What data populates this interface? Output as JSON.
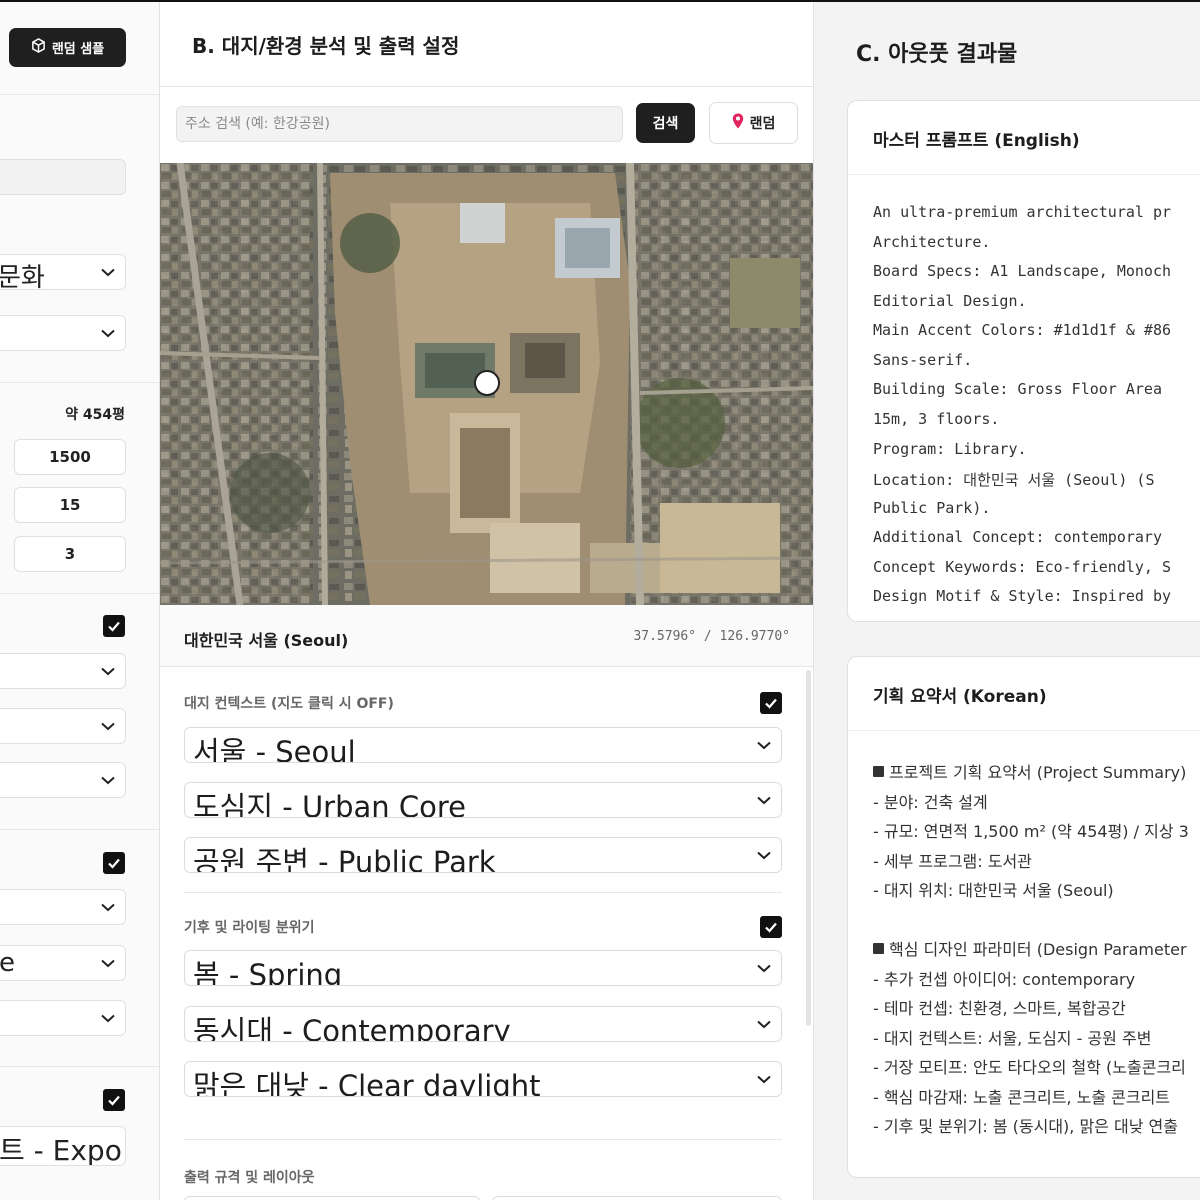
{
  "panel_a": {
    "random_sample_label": "랜덤 샘플",
    "culture_select_value": "문화",
    "area_display": "약 454평",
    "gross_floor_area": "1500",
    "height": "15",
    "floors": "3",
    "expo_select_value": "트 - Expo",
    "partial_select_e": "e"
  },
  "panel_b": {
    "title": "B. 대지/환경 분석 및 출력 설정",
    "search_placeholder": "주소 검색 (예: 한강공원)",
    "search_button": "검색",
    "random_button": "랜덤",
    "location_name": "대한민국 서울 (Seoul)",
    "coordinates": "37.5796° / 126.9770°",
    "site_context": {
      "label": "대지 컨텍스트 (지도 클릭 시 OFF)",
      "checked": true,
      "selects": [
        "서울 - Seoul",
        "도심지 - Urban Core",
        "공원 주변 - Public Park"
      ]
    },
    "climate": {
      "label": "기후 및 라이팅 분위기",
      "checked": true,
      "selects": [
        "봄 - Spring",
        "동시대 - Contemporary",
        "맑은 대낮 - Clear daylight"
      ]
    },
    "output_label": "출력 규격 및 레이아웃"
  },
  "panel_c": {
    "title": "C. 아웃풋 결과물",
    "master_prompt": {
      "header": "마스터 프롬프트 (English)",
      "lines": [
        "An ultra-premium architectural pr",
        "Architecture.",
        "Board Specs: A1 Landscape, Monoch",
        "Editorial Design.",
        "Main Accent Colors: #1d1d1f & #86",
        "Sans-serif.",
        "Building Scale: Gross Floor Area ",
        "15m, 3 floors.",
        "Program: Library.",
        "Location: 대한민국 서울 (Seoul) (S",
        "Public Park).",
        "Additional Concept: contemporary ",
        "Concept Keywords: Eco-friendly, S",
        "Design Motif & Style: Inspired by"
      ]
    },
    "summary": {
      "header": "기획 요약서 (Korean)",
      "section1_title": "프로젝트 기획 요약서 (Project Summary)",
      "section1_lines": [
        "- 분야: 건축 설계",
        "- 규모: 연면적 1,500 m² (약 454평) / 지상 3",
        "- 세부 프로그램: 도서관",
        "- 대지 위치: 대한민국 서울 (Seoul)"
      ],
      "section2_title": "핵심 디자인 파라미터 (Design Parameter",
      "section2_lines": [
        "- 추가 컨셉 아이디어: contemporary",
        "- 테마 컨셉: 친환경, 스마트, 복합공간",
        "- 대지 컨텍스트: 서울, 도심지 - 공원 주변",
        "- 거장 모티프: 안도 타다오의 철학 (노출콘크리",
        "- 핵심 마감재: 노출 콘크리트, 노출 콘크리트",
        "- 기후 및 분위기: 봄 (동시대), 맑은 대낮 연출"
      ]
    }
  },
  "colors": {
    "primary_dark": "#1d1d1f",
    "accent_grey": "#86868b",
    "panel_bg": "#ffffff",
    "app_bg": "#f4f4f4"
  }
}
